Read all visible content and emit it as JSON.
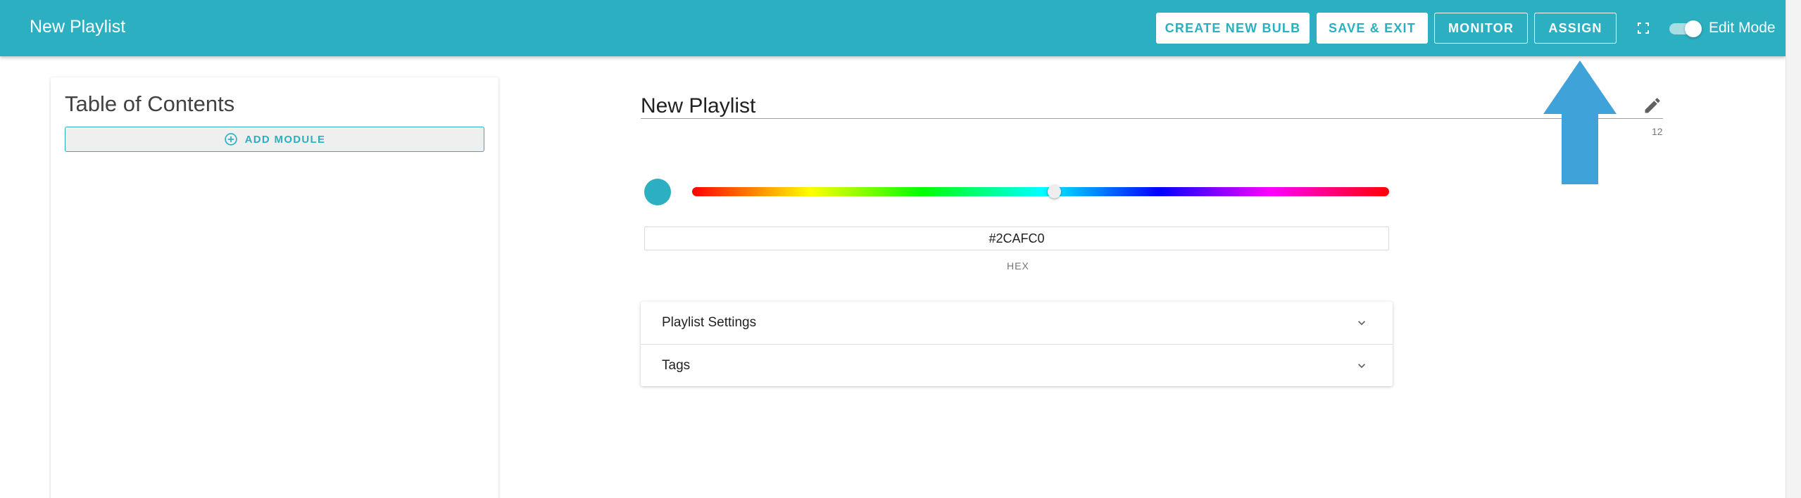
{
  "header": {
    "title": "New Playlist",
    "buttons": {
      "create_new_bulb": "CREATE NEW BULB",
      "save_exit": "SAVE & EXIT",
      "monitor": "MONITOR",
      "assign": "ASSIGN"
    },
    "fullscreen_icon": "fullscreen-icon",
    "edit_mode": {
      "label": "Edit Mode",
      "on": true
    }
  },
  "sidebar": {
    "title": "Table of Contents",
    "add_module_label": "ADD MODULE",
    "add_module_icon": "add-circle-icon"
  },
  "main": {
    "playlist_name": "New Playlist",
    "char_count": "12",
    "edit_icon": "pencil-icon",
    "color": {
      "hex_value": "#2CAFC0",
      "hex_label": "HEX",
      "swatch": "#2cafc0",
      "hue_position": 0.52
    },
    "panels": [
      {
        "label": "Playlist Settings",
        "icon": "chevron-down-icon"
      },
      {
        "label": "Tags",
        "icon": "chevron-down-icon"
      }
    ]
  },
  "colors": {
    "accent": "#2cafc0",
    "arrow": "#3fa2d8"
  }
}
